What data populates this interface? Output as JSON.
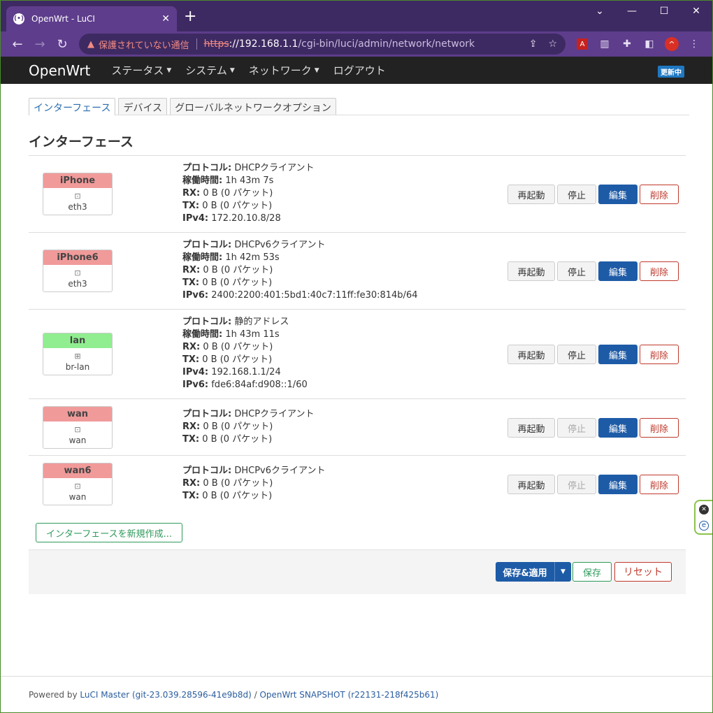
{
  "browser": {
    "tab_title": "OpenWrt - LuCI",
    "tab_favicon": "((•))",
    "new_tab": "+",
    "insecure_label": "保護されていない通信",
    "url_scheme": "https",
    "url_host": "://192.168.1.1",
    "url_path": "/cgi-bin/luci/admin/network/network",
    "profile_initial": "^"
  },
  "header": {
    "brand": "OpenWrt",
    "menu": [
      "ステータス",
      "システム",
      "ネットワーク",
      "ログアウト"
    ],
    "badge": "更新中"
  },
  "tabs": [
    "インターフェース",
    "デバイス",
    "グローバルネットワークオプション"
  ],
  "section_title": "インターフェース",
  "labels": {
    "protocol": "プロトコル:",
    "uptime": "稼働時間:",
    "rx": "RX:",
    "tx": "TX:",
    "ipv4": "IPv4:",
    "ipv6": "IPv6:"
  },
  "buttons": {
    "restart": "再起動",
    "stop": "停止",
    "edit": "編集",
    "delete": "削除",
    "add": "インターフェースを新規作成...",
    "save_apply": "保存&適用",
    "save": "保存",
    "reset": "リセット"
  },
  "interfaces": [
    {
      "name": "iPhone",
      "device": "eth3",
      "status_color": "#f19a9a",
      "protocol": "DHCPクライアント",
      "uptime": "1h 43m 7s",
      "rx": "0 B (0 パケット)",
      "tx": "0 B (0 パケット)",
      "ipv4": "172.20.10.8/28"
    },
    {
      "name": "iPhone6",
      "device": "eth3",
      "status_color": "#f19a9a",
      "protocol": "DHCPv6クライアント",
      "uptime": "1h 42m 53s",
      "rx": "0 B (0 パケット)",
      "tx": "0 B (0 パケット)",
      "ipv6": "2400:2200:401:5bd1:40c7:11ff:fe30:814b/64"
    },
    {
      "name": "lan",
      "device": "br-lan",
      "status_color": "#90ee90",
      "protocol": "静的アドレス",
      "uptime": "1h 43m 11s",
      "rx": "0 B (0 パケット)",
      "tx": "0 B (0 パケット)",
      "ipv4": "192.168.1.1/24",
      "ipv6": "fde6:84af:d908::1/60"
    },
    {
      "name": "wan",
      "device": "wan",
      "status_color": "#f19a9a",
      "protocol": "DHCPクライアント",
      "rx": "0 B (0 パケット)",
      "tx": "0 B (0 パケット)"
    },
    {
      "name": "wan6",
      "device": "wan",
      "status_color": "#f19a9a",
      "protocol": "DHCPv6クライアント",
      "rx": "0 B (0 パケット)",
      "tx": "0 B (0 パケット)"
    }
  ],
  "footer": {
    "powered_by": "Powered by ",
    "luci_link": "LuCI Master (git-23.039.28596-41e9b8d)",
    "separator": " / ",
    "openwrt_link": "OpenWrt SNAPSHOT (r22131-218f425b61)"
  }
}
